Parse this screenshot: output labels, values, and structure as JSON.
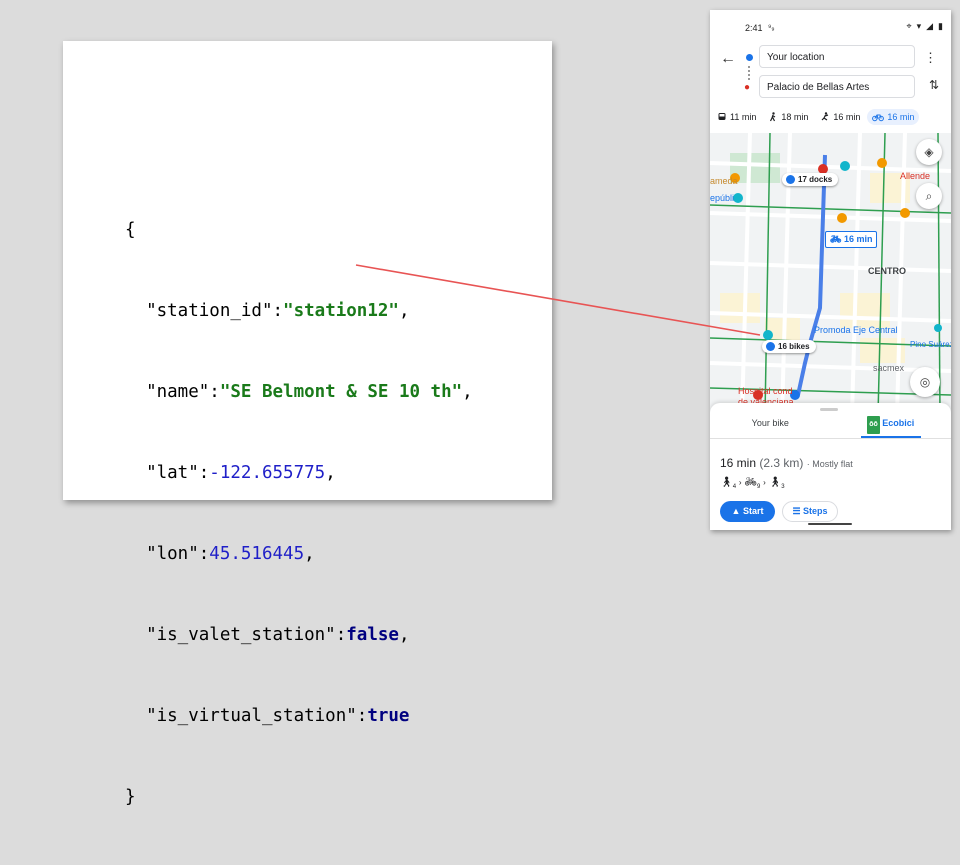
{
  "code_panel": {
    "lines": [
      {
        "key": "{",
        "val": ""
      },
      {
        "key": "  \"station_id\":",
        "val": "\"station12\"",
        "tail": ","
      },
      {
        "key": "  \"name\":",
        "val": "\"SE Belmont & SE 10 th\"",
        "tail": ","
      },
      {
        "key": "  \"lat\":",
        "val": "-122.655775",
        "tail": ","
      },
      {
        "key": "  \"lon\":",
        "val": "45.516445",
        "tail": ","
      },
      {
        "key": "  \"is_valet_station\":",
        "val": "false",
        "tail": ","
      },
      {
        "key": "  \"is_virtual_station\":",
        "val": "true",
        "tail": ""
      },
      {
        "key": "}",
        "val": ""
      }
    ],
    "colors": {
      "string": "#1a7a1a",
      "number": "#1f1fc8",
      "boolean": "#000080",
      "connector": "#e85454"
    }
  },
  "phone": {
    "status": {
      "time": "2:41",
      "sim": "⁹₉"
    },
    "route": {
      "from": "Your location",
      "to": "Palacio de Bellas Artes"
    },
    "modes": [
      {
        "name": "transit",
        "time": "11 min"
      },
      {
        "name": "walk",
        "time": "18 min"
      },
      {
        "name": "ride",
        "time": "16 min"
      },
      {
        "name": "bike",
        "time": "16 min"
      }
    ],
    "map": {
      "docks_chip": "17 docks",
      "bikes_chip": "16 bikes",
      "route_time": "16 min",
      "labels": {
        "centro": "CENTRO",
        "allende": "Allende",
        "alameda": "ameda",
        "republica": "epúbli",
        "promenade": "Promoda Eje Central",
        "pino": "Pino Suárez",
        "sacmex": "sacmex",
        "hospital": "Hospital cond",
        "hospital2": "de valenciana"
      }
    },
    "sheet": {
      "tab_bike": "Your bike",
      "tab_ecobici": "Ecobici",
      "duration": "16 min",
      "distance": "(2.3 km)",
      "terrain": "Mostly flat",
      "start_label": "Start",
      "steps_label": "Steps"
    }
  }
}
